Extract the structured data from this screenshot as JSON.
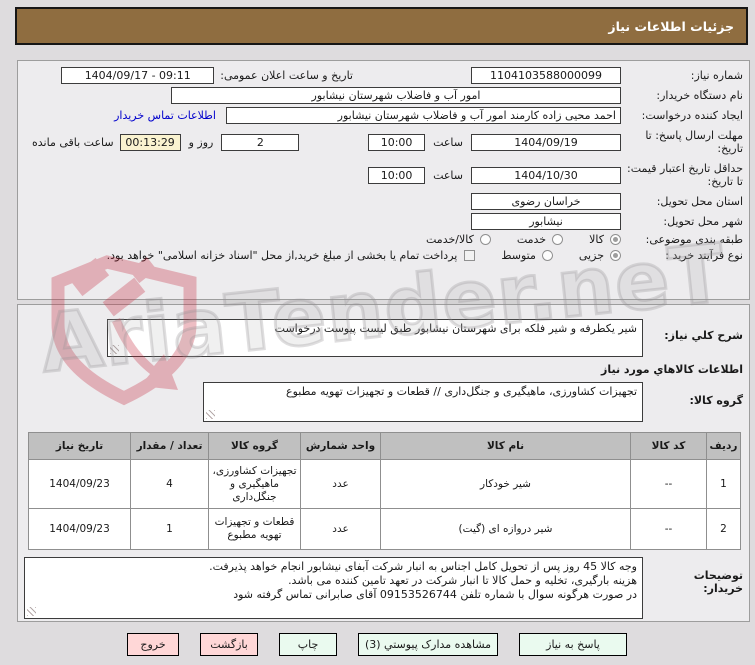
{
  "header": {
    "title": "جزئیات اطلاعات نیاز"
  },
  "form": {
    "need_no": {
      "label": "شماره نیاز:",
      "value": "1104103588000099"
    },
    "announce": {
      "label": "تاریخ و ساعت اعلان عمومی:",
      "value": "1404/09/17 - 09:11"
    },
    "buyer_org": {
      "label": "نام دستگاه خریدار:",
      "value": "امور آب و فاضلاب شهرستان نیشابور"
    },
    "creator": {
      "label": "ایجاد کننده درخواست:",
      "value": "احمد محیی زاده کارمند امور آب و فاضلاب شهرستان نیشابور",
      "contact_link": "اطلاعات تماس خریدار"
    },
    "deadline": {
      "label": "مهلت ارسال پاسخ: تا تاریخ:",
      "date": "1404/09/19",
      "hour_label": "ساعت",
      "time": "10:00",
      "days_value": "2",
      "days_label": "روز و",
      "countdown": "00:13:29",
      "countdown_label": "ساعت باقی مانده"
    },
    "price_validity": {
      "label": "حداقل تاریخ اعتبار قیمت: تا تاریخ:",
      "date": "1404/10/30",
      "hour_label": "ساعت",
      "time": "10:00"
    },
    "province": {
      "label": "استان محل تحویل:",
      "value": "خراسان رضوی"
    },
    "city": {
      "label": "شهر محل تحویل:",
      "value": "نیشابور"
    },
    "category": {
      "label": "طبقه بندی موضوعی:",
      "opt1": "کالا",
      "opt2": "خدمت",
      "opt3": "کالا/خدمت",
      "selected": "کالا"
    },
    "process": {
      "label": "نوع فرآیند خرید :",
      "opt1": "جزیی",
      "opt2": "متوسط",
      "selected": "جزیی",
      "checkbox_label": "پرداخت تمام یا بخشی از مبلغ خرید,از محل \"اسناد خزانه اسلامی\" خواهد بود."
    }
  },
  "description": {
    "label": "شرح کلي نیاز:",
    "value": "شیر یکطرفه و شیر فلکه برای شهرستان نیشابور طبق لیست پیوست درخواست"
  },
  "goods_section": {
    "title": "اطلاعات کالاهاي مورد نیاز",
    "group_label": "گروه کالا:",
    "group_value": "تجهیزات کشاورزی، ماهیگیری و جنگل‌داری //  قطعات و تجهیزات تهویه مطبوع"
  },
  "table": {
    "headers": {
      "row": "ردیف",
      "code": "کد کالا",
      "name": "نام کالا",
      "unit": "واحد شمارش",
      "group": "گروه کالا",
      "qty": "تعداد / مقدار",
      "date": "تاریخ نیاز"
    },
    "rows": [
      {
        "row": "1",
        "code": "--",
        "name": "شیر خودکار",
        "unit": "عدد",
        "group": "تجهیزات کشاورزی، ماهیگیری و جنگل‌داری",
        "qty": "4",
        "date": "1404/09/23"
      },
      {
        "row": "2",
        "code": "--",
        "name": "شیر دروازه ای (گیت)",
        "unit": "عدد",
        "group": "قطعات و تجهیزات تهویه مطبوع",
        "qty": "1",
        "date": "1404/09/23"
      }
    ]
  },
  "remarks": {
    "label_line1": "توضیحات",
    "label_line2": "خریدار:",
    "value": "وجه کالا 45 روز پس از تحویل کامل اجناس به انبار شرکت آبفای نیشابور انجام خواهد پذیرفت.\nهزینه بارگیری، تخلیه و حمل کالا تا انبار شرکت در تعهد تامین کننده می باشد.\nدر صورت هرگونه سوال با شماره تلفن 09153526744 آقای صابرانی تماس گرفته شود"
  },
  "footer": {
    "respond": "پاسخ به نیاز",
    "view_docs": "مشاهده مدارک پیوستي (3)",
    "print": "چاپ",
    "back": "بازگشت",
    "exit": "خروج"
  },
  "watermark": {
    "text": "AriaTender.neT"
  },
  "colors": {
    "header_bg": "#8f6d40",
    "panel_bg": "#edecee",
    "link": "#0000cc",
    "countdown_bg": "#faf3d0",
    "button_green": "#eafaef",
    "button_pink": "#ffd7d7",
    "table_header_bg": "#c0c0c0",
    "watermark_red": "#c5273b"
  }
}
